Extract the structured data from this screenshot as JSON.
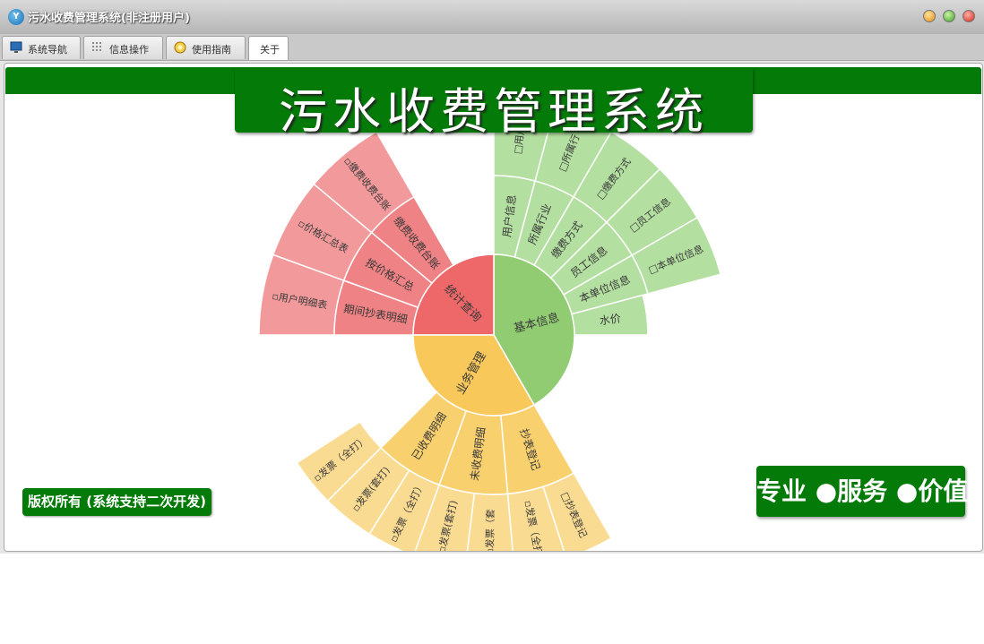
{
  "window": {
    "title": "污水收费管理系统(非注册用户)"
  },
  "tabs": [
    {
      "label": "系统导航",
      "icon": "monitor-icon"
    },
    {
      "label": "信息操作",
      "icon": "grid-icon"
    },
    {
      "label": "使用指南",
      "icon": "guide-icon"
    },
    {
      "label": "关于",
      "icon": ""
    }
  ],
  "active_tab": "关于",
  "banner": {
    "title": "污水收费管理系统"
  },
  "footer": {
    "copyright": "版权所有 (系统支持二次开发)",
    "slogan": "专业 ●服务 ●价值"
  },
  "sunburst": {
    "center": [
      {
        "label": "基本信息",
        "color": "#92cc72"
      },
      {
        "label": "统计查询",
        "color": "#ee686a"
      },
      {
        "label": "业务管理",
        "color": "#f8c85a"
      }
    ],
    "ring1": [
      {
        "label": "用户信息",
        "parent": "基本信息"
      },
      {
        "label": "所属行业",
        "parent": "基本信息"
      },
      {
        "label": "缴费方式",
        "parent": "基本信息"
      },
      {
        "label": "员工信息",
        "parent": "基本信息"
      },
      {
        "label": "本单位信息",
        "parent": "基本信息"
      },
      {
        "label": "水价",
        "parent": "基本信息"
      },
      {
        "label": "期间抄表明细",
        "parent": "统计查询"
      },
      {
        "label": "按价格汇总",
        "parent": "统计查询"
      },
      {
        "label": "缴费收费台账",
        "parent": "统计查询"
      },
      {
        "label": "抄表登记",
        "parent": "业务管理"
      },
      {
        "label": "未收费明细",
        "parent": "业务管理"
      },
      {
        "label": "已收费明细",
        "parent": "业务管理"
      }
    ],
    "ring2": [
      {
        "label": "□用户",
        "parent": "用户信息"
      },
      {
        "label": "□所属行",
        "parent": "所属行业"
      },
      {
        "label": "□缴费方式",
        "parent": "缴费方式"
      },
      {
        "label": "□员工信息",
        "parent": "员工信息"
      },
      {
        "label": "□本单位信息",
        "parent": "本单位信息"
      },
      {
        "label": "▫用户明细表",
        "parent": "期间抄表明细"
      },
      {
        "label": "▫价格汇总表",
        "parent": "按价格汇总"
      },
      {
        "label": "▫缴费收费台账",
        "parent": "缴费收费台账"
      },
      {
        "label": "□抄表登记",
        "parent": "抄表登记"
      },
      {
        "label": "▫发票（全打",
        "parent": "抄表登记"
      },
      {
        "label": "▫发票（套",
        "parent": "未收费明细"
      },
      {
        "label": "▫发票(套打)",
        "parent": "未收费明细"
      },
      {
        "label": "▫发票（全打）",
        "parent": "未收费明细"
      },
      {
        "label": "▫发票(套打)",
        "parent": "已收费明细"
      },
      {
        "label": "▫发票（全打）",
        "parent": "已收费明细"
      }
    ]
  },
  "colors": {
    "brand_green": "#047a08",
    "basic_inner": "#92cc72",
    "basic_outer": "#b3dfa0",
    "stats_inner": "#ee686a",
    "stats_ring1": "#ef8284",
    "stats_ring2": "#f29a9b",
    "biz_inner": "#f8c85a",
    "biz_ring1": "#f9d06e",
    "biz_ring2": "#fadb92"
  }
}
